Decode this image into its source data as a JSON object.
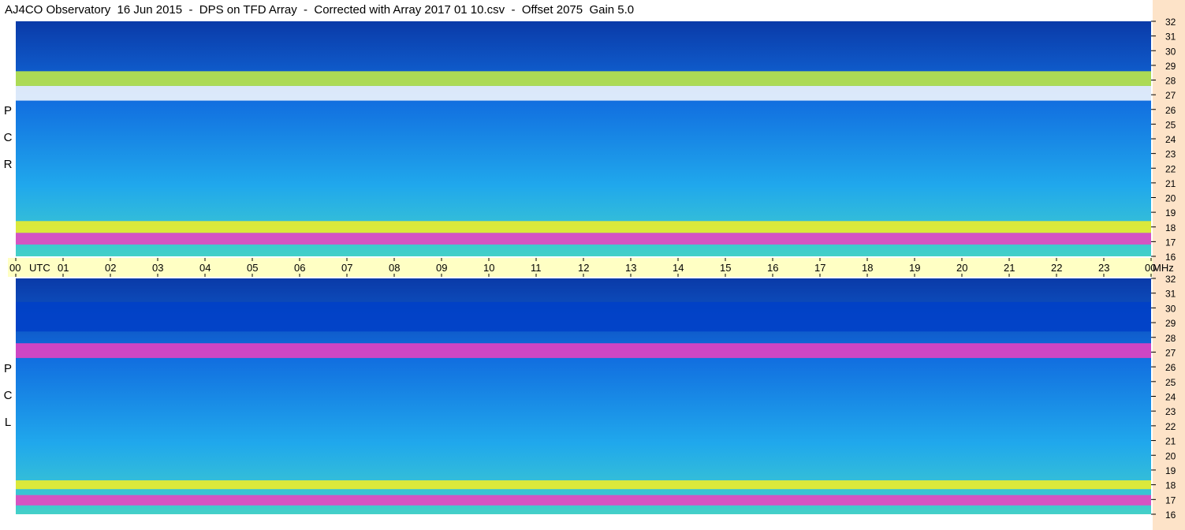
{
  "title": "AJ4CO Observatory  16 Jun 2015  -  DPS on TFD Array  -  Corrected with Array 2017 01 10.csv  -  Offset 2075  Gain 5.0",
  "chart_data": {
    "type": "heatmap",
    "title": "AJ4CO Observatory  16 Jun 2015  -  DPS on TFD Array  -  Corrected with Array 2017 01 10.csv  -  Offset 2075  Gain 5.0",
    "x_axis": {
      "unit_label": "UTC",
      "range_hours": [
        0,
        24
      ],
      "tick_labels": [
        "00",
        "01",
        "02",
        "03",
        "04",
        "05",
        "06",
        "07",
        "08",
        "09",
        "10",
        "11",
        "12",
        "13",
        "14",
        "15",
        "16",
        "17",
        "18",
        "19",
        "20",
        "21",
        "22",
        "23",
        "00"
      ]
    },
    "y_axis": {
      "unit_label": "MHz",
      "range_mhz": [
        16,
        32
      ],
      "tick_labels": [
        "16",
        "17",
        "18",
        "19",
        "20",
        "21",
        "22",
        "23",
        "24",
        "25",
        "26",
        "27",
        "28",
        "29",
        "30",
        "31",
        "32"
      ]
    },
    "panels": [
      {
        "polarization_letters": [
          "R",
          "C",
          "P"
        ],
        "intensity_bands": [
          {
            "mhz": [
              16.8,
              17.6
            ],
            "level": 0.92
          },
          {
            "mhz": [
              17.6,
              18.4
            ],
            "level": 0.78
          },
          {
            "mhz": [
              26.6,
              27.6
            ],
            "level": 0.95
          },
          {
            "mhz": [
              27.6,
              28.6
            ],
            "level": 0.68
          }
        ]
      },
      {
        "polarization_letters": [
          "L",
          "C",
          "P"
        ],
        "intensity_bands": [
          {
            "mhz": [
              16.6,
              17.3
            ],
            "level": 0.88
          },
          {
            "mhz": [
              17.7,
              18.3
            ],
            "level": 0.72
          },
          {
            "mhz": [
              26.6,
              27.6
            ],
            "level": 0.92
          },
          {
            "mhz": [
              28.4,
              30.4
            ],
            "level": 0.1
          }
        ]
      }
    ],
    "colormap": [
      "#001a66",
      "#0040c8",
      "#1878f0",
      "#20b8f0",
      "#58e0b0",
      "#c8f040",
      "#f8f020",
      "#f040c0",
      "#ffffff"
    ],
    "grid": false,
    "legend": "none"
  }
}
